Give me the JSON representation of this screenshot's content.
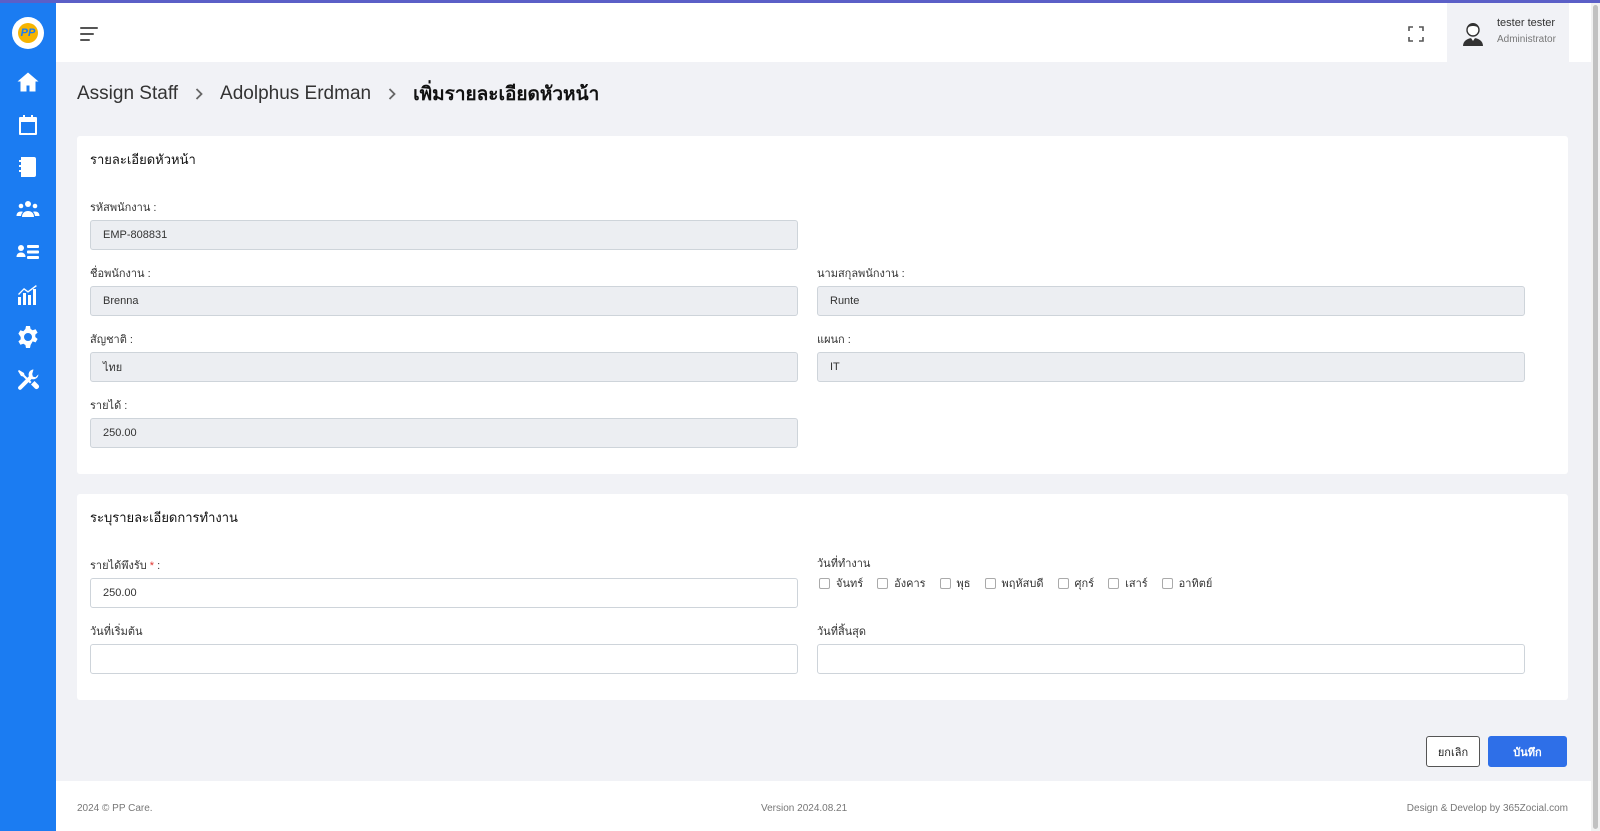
{
  "app": {
    "logo_text": "PP"
  },
  "sidebar": {
    "items": [
      {
        "name": "home",
        "icon": "home-icon"
      },
      {
        "name": "billing-calendar",
        "icon": "calendar-dollar-icon"
      },
      {
        "name": "contacts",
        "icon": "contact-book-icon"
      },
      {
        "name": "team",
        "icon": "users-group-icon"
      },
      {
        "name": "assign-staff",
        "icon": "list-user-icon"
      },
      {
        "name": "reports",
        "icon": "bar-chart-icon"
      },
      {
        "name": "settings",
        "icon": "gear-icon"
      },
      {
        "name": "tools",
        "icon": "tools-icon"
      }
    ]
  },
  "header": {
    "menu_icon": "hamburger-icon",
    "fullscreen_icon": "fullscreen-icon",
    "user": {
      "name": "tester tester",
      "role": "Administrator"
    }
  },
  "breadcrumb": {
    "items": [
      "Assign Staff",
      "Adolphus Erdman"
    ],
    "current": "เพิ่มรายละเอียดหัวหน้า"
  },
  "details_card": {
    "title": "รายละเอียดหัวหน้า",
    "employee_code": {
      "label": "รหัสพนักงาน :",
      "value": "EMP-808831"
    },
    "first_name": {
      "label": "ชื่อพนักงาน :",
      "value": "Brenna"
    },
    "last_name": {
      "label": "นามสกุลพนักงาน :",
      "value": "Runte"
    },
    "nationality": {
      "label": "สัญชาติ :",
      "value": "ไทย"
    },
    "department": {
      "label": "แผนก :",
      "value": "IT"
    },
    "income": {
      "label": "รายได้ :",
      "value": "250.00"
    }
  },
  "work_card": {
    "title": "ระบุรายละเอียดการทำงาน",
    "expected_income": {
      "label": "รายได้พึงรับ",
      "required_mark": "*",
      "suffix": " :",
      "value": "250.00"
    },
    "work_days": {
      "label": "วันที่ทำงาน",
      "days": [
        {
          "label": "จันทร์",
          "checked": false
        },
        {
          "label": "อังคาร",
          "checked": false
        },
        {
          "label": "พุธ",
          "checked": false
        },
        {
          "label": "พฤหัสบดี",
          "checked": false
        },
        {
          "label": "ศุกร์",
          "checked": false
        },
        {
          "label": "เสาร์",
          "checked": false
        },
        {
          "label": "อาทิตย์",
          "checked": false
        }
      ]
    },
    "start_date": {
      "label": "วันที่เริ่มต้น",
      "value": ""
    },
    "end_date": {
      "label": "วันที่สิ้นสุด",
      "value": ""
    }
  },
  "actions": {
    "cancel_label": "ยกเลิก",
    "save_label": "บันทึก"
  },
  "footer": {
    "copyright": "2024 © PP Care.",
    "version": "Version 2024.08.21",
    "credit": "Design & Develop by 365Zocial.com"
  },
  "colors": {
    "sidebar": "#1b7cf2",
    "primary_button": "#2e6fe8",
    "background": "#f1f2f6",
    "required": "#e0342f"
  }
}
